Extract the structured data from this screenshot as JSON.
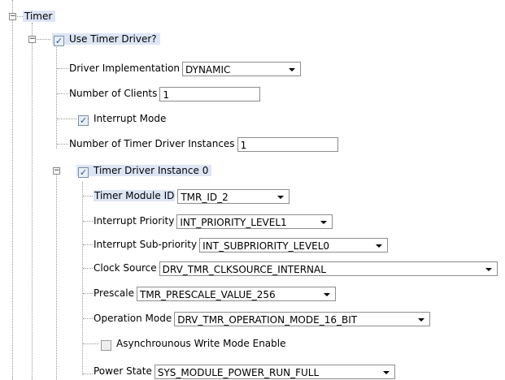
{
  "tree": {
    "root": {
      "label": "Timer"
    },
    "use_driver": {
      "label": "Use Timer Driver?",
      "checked": true
    },
    "driver_impl": {
      "label": "Driver Implementation",
      "value": "DYNAMIC"
    },
    "num_clients": {
      "label": "Number of Clients",
      "value": "1"
    },
    "interrupt_mode": {
      "label": "Interrupt Mode",
      "checked": true
    },
    "num_instances": {
      "label": "Number of Timer Driver Instances",
      "value": "1"
    },
    "instance0": {
      "label": "Timer Driver Instance 0",
      "checked": true,
      "module_id": {
        "label": "Timer Module ID",
        "value": "TMR_ID_2"
      },
      "int_priority": {
        "label": "Interrupt Priority",
        "value": "INT_PRIORITY_LEVEL1"
      },
      "int_subpriority": {
        "label": "Interrupt Sub-priority",
        "value": "INT_SUBPRIORITY_LEVEL0"
      },
      "clock_source": {
        "label": "Clock Source",
        "value": "DRV_TMR_CLKSOURCE_INTERNAL"
      },
      "prescale": {
        "label": "Prescale",
        "value": "TMR_PRESCALE_VALUE_256"
      },
      "operation_mode": {
        "label": "Operation Mode",
        "value": "DRV_TMR_OPERATION_MODE_16_BIT"
      },
      "async_write": {
        "label": "Asynchrounous Write Mode Enable",
        "checked": false
      },
      "power_state": {
        "label": "Power State",
        "value": "SYS_MODULE_POWER_RUN_FULL"
      }
    }
  }
}
